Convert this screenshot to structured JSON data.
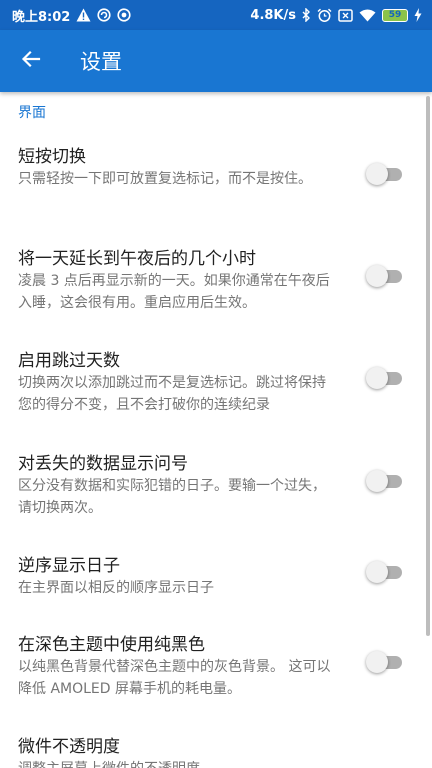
{
  "status_bar": {
    "time": "晚上8:02",
    "network_speed": "4.8K/s",
    "battery_level": "59",
    "icons_left": [
      "warning-icon",
      "sync-icon",
      "data-saver-icon"
    ],
    "icons_right": [
      "bluetooth-icon",
      "alarm-icon",
      "no-sim-icon",
      "wifi-icon",
      "battery-icon",
      "charging-icon"
    ]
  },
  "app_bar": {
    "title": "设置",
    "back_icon": "arrow-left-icon"
  },
  "section": {
    "header": "界面"
  },
  "preferences": [
    {
      "title": "短按切换",
      "summary": "只需轻按一下即可放置复选标记，而不是按住。",
      "enabled": false
    },
    {
      "title": "将一天延长到午夜后的几个小时",
      "summary": "凌晨 3 点后再显示新的一天。如果你通常在午夜后入睡，这会很有用。重启应用后生效。",
      "enabled": false
    },
    {
      "title": "启用跳过天数",
      "summary": "切换两次以添加跳过而不是复选标记。跳过将保持您的得分不变，且不会打破你的连续纪录",
      "enabled": false
    },
    {
      "title": "对丢失的数据显示问号",
      "summary": "区分没有数据和实际犯错的日子。要输一个过失，请切换两次。",
      "enabled": false
    },
    {
      "title": "逆序显示日子",
      "summary": "在主界面以相反的顺序显示日子",
      "enabled": false
    },
    {
      "title": "在深色主题中使用纯黑色",
      "summary": "以纯黑色背景代替深色主题中的灰色背景。 这可以降低 AMOLED 屏幕手机的耗电量。",
      "enabled": false
    },
    {
      "title": "微件不透明度",
      "summary": "调整主屏幕上微件的不透明度"
    }
  ],
  "colors": {
    "status_bar": "#1565c0",
    "app_bar": "#1976d2",
    "accent": "#1976d2",
    "title_text": "#212121",
    "summary_text": "#757575"
  }
}
